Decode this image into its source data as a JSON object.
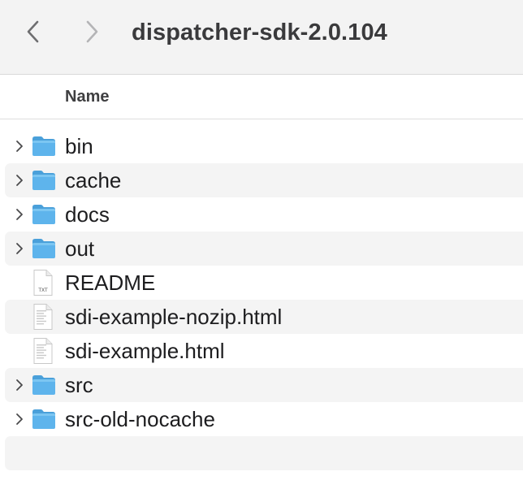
{
  "toolbar": {
    "title": "dispatcher-sdk-2.0.104",
    "back_icon": "chevron-left-icon",
    "forward_icon": "chevron-right-icon"
  },
  "columns": {
    "name": "Name"
  },
  "items": [
    {
      "label": "bin",
      "kind": "folder",
      "expandable": true
    },
    {
      "label": "cache",
      "kind": "folder",
      "expandable": true
    },
    {
      "label": "docs",
      "kind": "folder",
      "expandable": true
    },
    {
      "label": "out",
      "kind": "folder",
      "expandable": true
    },
    {
      "label": "README",
      "kind": "text-document",
      "badge": "TXT",
      "expandable": false
    },
    {
      "label": "sdi-example-nozip.html",
      "kind": "html-document",
      "expandable": false
    },
    {
      "label": "sdi-example.html",
      "kind": "html-document",
      "expandable": false
    },
    {
      "label": "src",
      "kind": "folder",
      "expandable": true
    },
    {
      "label": "src-old-nocache",
      "kind": "folder",
      "expandable": true
    }
  ],
  "colors": {
    "folder": "#5eb4ec",
    "folder_tab": "#4aa0da",
    "row_alt": "#f4f4f4",
    "toolbar_bg": "#f3f3f3"
  }
}
